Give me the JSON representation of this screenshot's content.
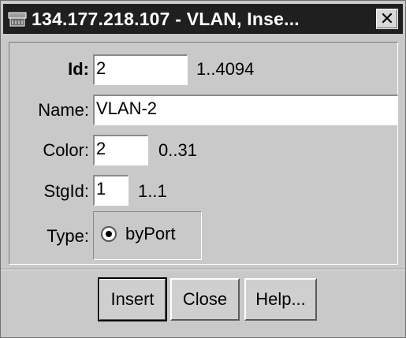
{
  "window": {
    "title": "134.177.218.107 - VLAN, Inse...",
    "title_icon": "network-device-icon",
    "close_glyph": "✕"
  },
  "form": {
    "id_label": "Id:",
    "id_value": "2",
    "id_range": "1..4094",
    "name_label": "Name:",
    "name_value": "VLAN-2",
    "color_label": "Color:",
    "color_value": "2",
    "color_range": "0..31",
    "stgid_label": "StgId:",
    "stgid_value": "1",
    "stgid_range": "1..1",
    "type_label": "Type:",
    "type_option": "byPort",
    "type_selected": true
  },
  "buttons": {
    "insert": "Insert",
    "close": "Close",
    "help": "Help..."
  },
  "colors": {
    "title_bg": "#1f1f1f",
    "dialog_bg": "#c9c9c9",
    "field_bg": "#ffffff"
  }
}
